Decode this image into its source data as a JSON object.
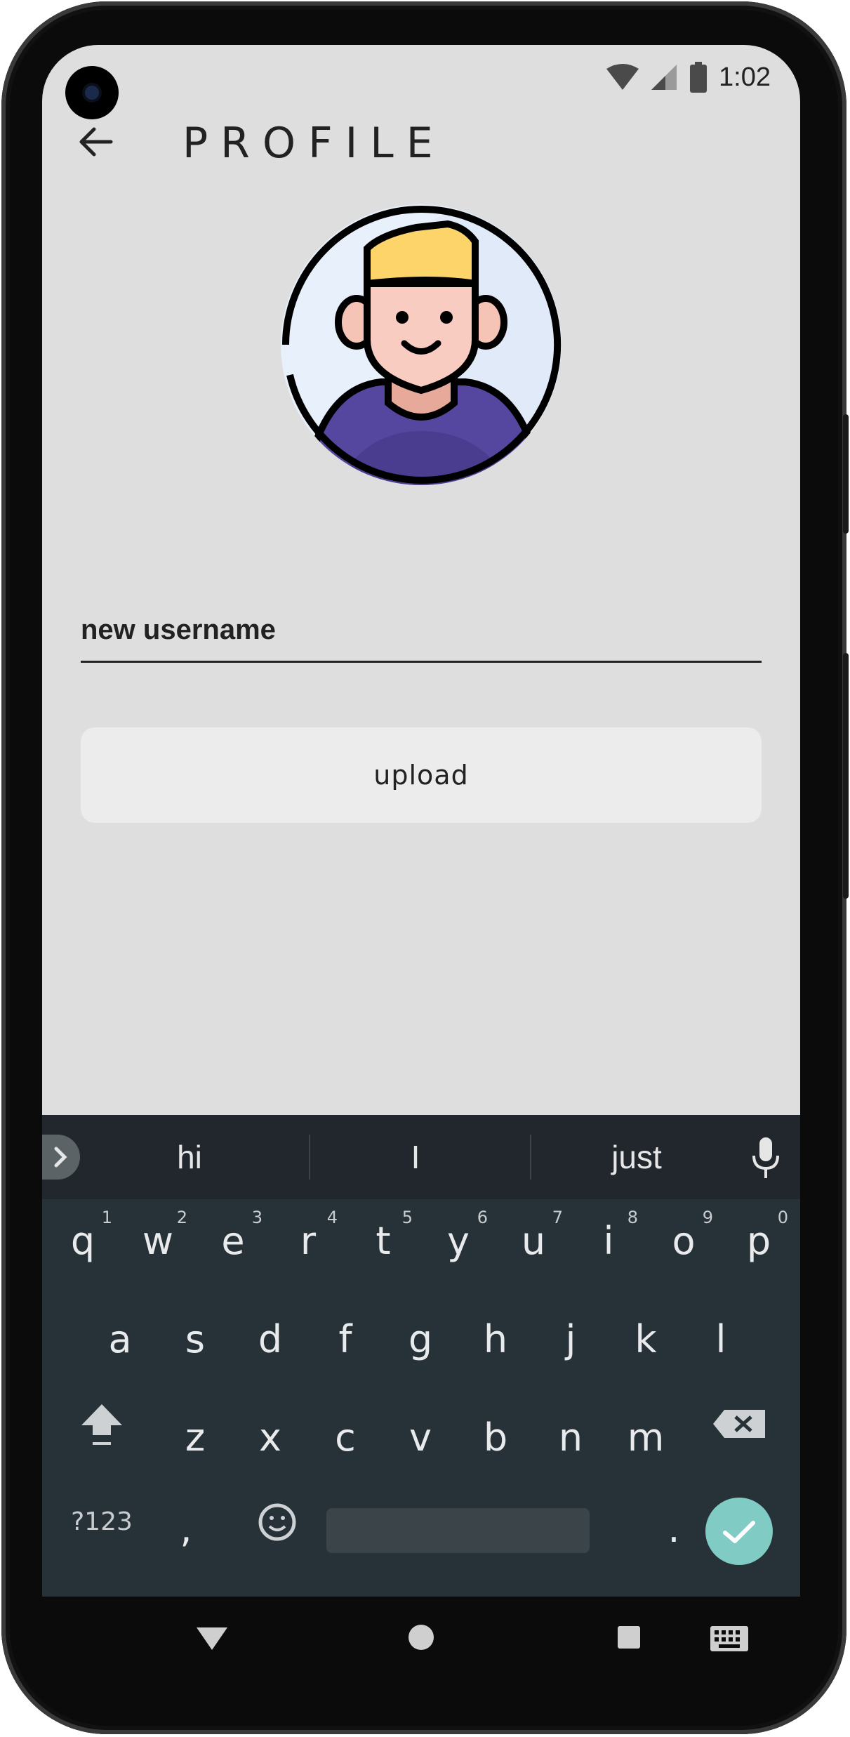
{
  "status_bar": {
    "time": "1:02"
  },
  "app_bar": {
    "title": "PROFILE"
  },
  "username_field": {
    "value": "new username"
  },
  "upload_button": {
    "label": "upload"
  },
  "keyboard": {
    "suggestions": [
      "hi",
      "I",
      "just"
    ],
    "row1": [
      {
        "k": "q",
        "n": "1"
      },
      {
        "k": "w",
        "n": "2"
      },
      {
        "k": "e",
        "n": "3"
      },
      {
        "k": "r",
        "n": "4"
      },
      {
        "k": "t",
        "n": "5"
      },
      {
        "k": "y",
        "n": "6"
      },
      {
        "k": "u",
        "n": "7"
      },
      {
        "k": "i",
        "n": "8"
      },
      {
        "k": "o",
        "n": "9"
      },
      {
        "k": "p",
        "n": "0"
      }
    ],
    "row2": [
      "a",
      "s",
      "d",
      "f",
      "g",
      "h",
      "j",
      "k",
      "l"
    ],
    "row3": [
      "z",
      "x",
      "c",
      "v",
      "b",
      "n",
      "m"
    ],
    "symbols_key": "?123",
    "comma_key": ",",
    "period_key": ".",
    "accent_color": "#80cbc4"
  }
}
